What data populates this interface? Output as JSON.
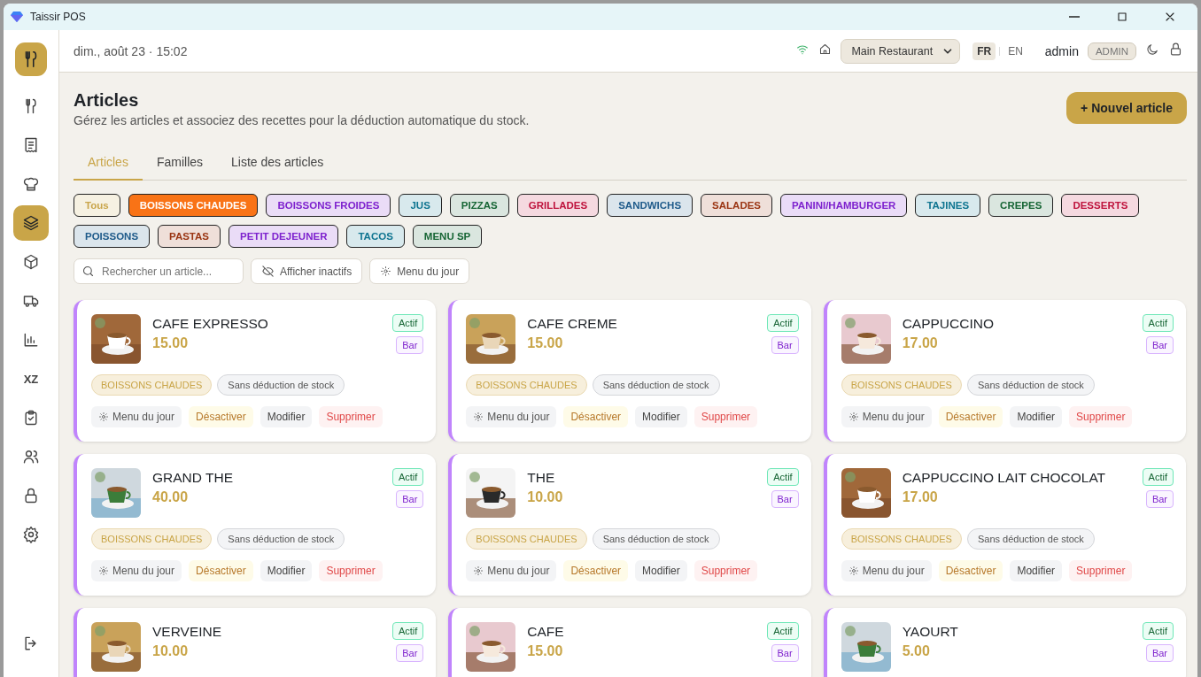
{
  "window": {
    "title": "Taissir POS"
  },
  "sidebar": {
    "items": [
      {
        "selected": false
      },
      {
        "selected": false
      },
      {
        "selected": false
      },
      {
        "selected": true
      },
      {
        "selected": false
      },
      {
        "selected": false
      },
      {
        "selected": false
      },
      {
        "selected": false,
        "label": "XZ"
      },
      {
        "selected": false
      },
      {
        "selected": false
      },
      {
        "selected": false
      },
      {
        "selected": false
      },
      {
        "selected": false
      }
    ]
  },
  "header": {
    "datetime": "dim., août 23 · 15:02",
    "restaurant": "Main Restaurant",
    "languages": [
      {
        "label": "FR",
        "selected": true
      },
      {
        "label": "EN",
        "selected": false
      }
    ],
    "user": "admin",
    "role": "ADMIN"
  },
  "page": {
    "title": "Articles",
    "subtitle": "Gérez les articles et associez des recettes pour la déduction automatique du stock.",
    "new_button": "+ Nouvel article"
  },
  "tabs": [
    {
      "label": "Articles",
      "selected": true
    },
    {
      "label": "Familles",
      "selected": false
    },
    {
      "label": "Liste des articles",
      "selected": false
    }
  ],
  "categories": [
    {
      "label": "Tous",
      "selected": false,
      "color": "#c9a54a"
    },
    {
      "label": "BOISSONS CHAUDES",
      "selected": true,
      "color": "#f97316"
    },
    {
      "label": "BOISSONS FROIDES",
      "selected": false,
      "color": "#7e22ce"
    },
    {
      "label": "JUS",
      "selected": false,
      "color": "#0e7490"
    },
    {
      "label": "PIZZAS",
      "selected": false,
      "color": "#166534"
    },
    {
      "label": "GRILLADES",
      "selected": false,
      "color": "#be123c"
    },
    {
      "label": "SANDWICHS",
      "selected": false,
      "color": "#1e5a8a"
    },
    {
      "label": "SALADES",
      "selected": false,
      "color": "#9a3412"
    },
    {
      "label": "PANINI/HAMBURGER",
      "selected": false,
      "color": "#7e22ce"
    },
    {
      "label": "TAJINES",
      "selected": false,
      "color": "#0e7490"
    },
    {
      "label": "CREPES",
      "selected": false,
      "color": "#166534"
    },
    {
      "label": "DESSERTS",
      "selected": false,
      "color": "#be123c"
    },
    {
      "label": "POISSONS",
      "selected": false,
      "color": "#1e5a8a"
    },
    {
      "label": "PASTAS",
      "selected": false,
      "color": "#9a3412"
    },
    {
      "label": "PETIT DEJEUNER",
      "selected": false,
      "color": "#7e22ce"
    },
    {
      "label": "TACOS",
      "selected": false,
      "color": "#0e7490"
    },
    {
      "label": "MENU SP",
      "selected": false,
      "color": "#166534"
    }
  ],
  "toolbar": {
    "search_placeholder": "Rechercher un article...",
    "show_inactive": "Afficher inactifs",
    "daily_menu": "Menu du jour"
  },
  "articles": [
    {
      "name": "CAFE EXPRESSO",
      "price": "15.00",
      "status": "Actif",
      "station": "Bar",
      "category": "BOISSONS CHAUDES",
      "stock": "Sans déduction de stock",
      "actions": [
        "Menu du jour",
        "Désactiver",
        "Modifier",
        "Supprimer"
      ]
    },
    {
      "name": "CAFE CREME",
      "price": "15.00",
      "status": "Actif",
      "station": "Bar",
      "category": "BOISSONS CHAUDES",
      "stock": "Sans déduction de stock",
      "actions": [
        "Menu du jour",
        "Désactiver",
        "Modifier",
        "Supprimer"
      ]
    },
    {
      "name": "CAPPUCCINO",
      "price": "17.00",
      "status": "Actif",
      "station": "Bar",
      "category": "BOISSONS CHAUDES",
      "stock": "Sans déduction de stock",
      "actions": [
        "Menu du jour",
        "Désactiver",
        "Modifier",
        "Supprimer"
      ]
    },
    {
      "name": "GRAND THE",
      "price": "40.00",
      "status": "Actif",
      "station": "Bar",
      "category": "BOISSONS CHAUDES",
      "stock": "Sans déduction de stock",
      "actions": [
        "Menu du jour",
        "Désactiver",
        "Modifier",
        "Supprimer"
      ]
    },
    {
      "name": "THE",
      "price": "10.00",
      "status": "Actif",
      "station": "Bar",
      "category": "BOISSONS CHAUDES",
      "stock": "Sans déduction de stock",
      "actions": [
        "Menu du jour",
        "Désactiver",
        "Modifier",
        "Supprimer"
      ]
    },
    {
      "name": "CAPPUCCINO LAIT CHOCOLAT",
      "price": "17.00",
      "status": "Actif",
      "station": "Bar",
      "category": "BOISSONS CHAUDES",
      "stock": "Sans déduction de stock",
      "actions": [
        "Menu du jour",
        "Désactiver",
        "Modifier",
        "Supprimer"
      ]
    },
    {
      "name": "VERVEINE",
      "price": "10.00",
      "status": "Actif",
      "station": "Bar"
    },
    {
      "name": "CAFE",
      "price": "15.00",
      "status": "Actif",
      "station": "Bar"
    },
    {
      "name": "YAOURT",
      "price": "5.00",
      "status": "Actif",
      "station": "Bar"
    }
  ]
}
